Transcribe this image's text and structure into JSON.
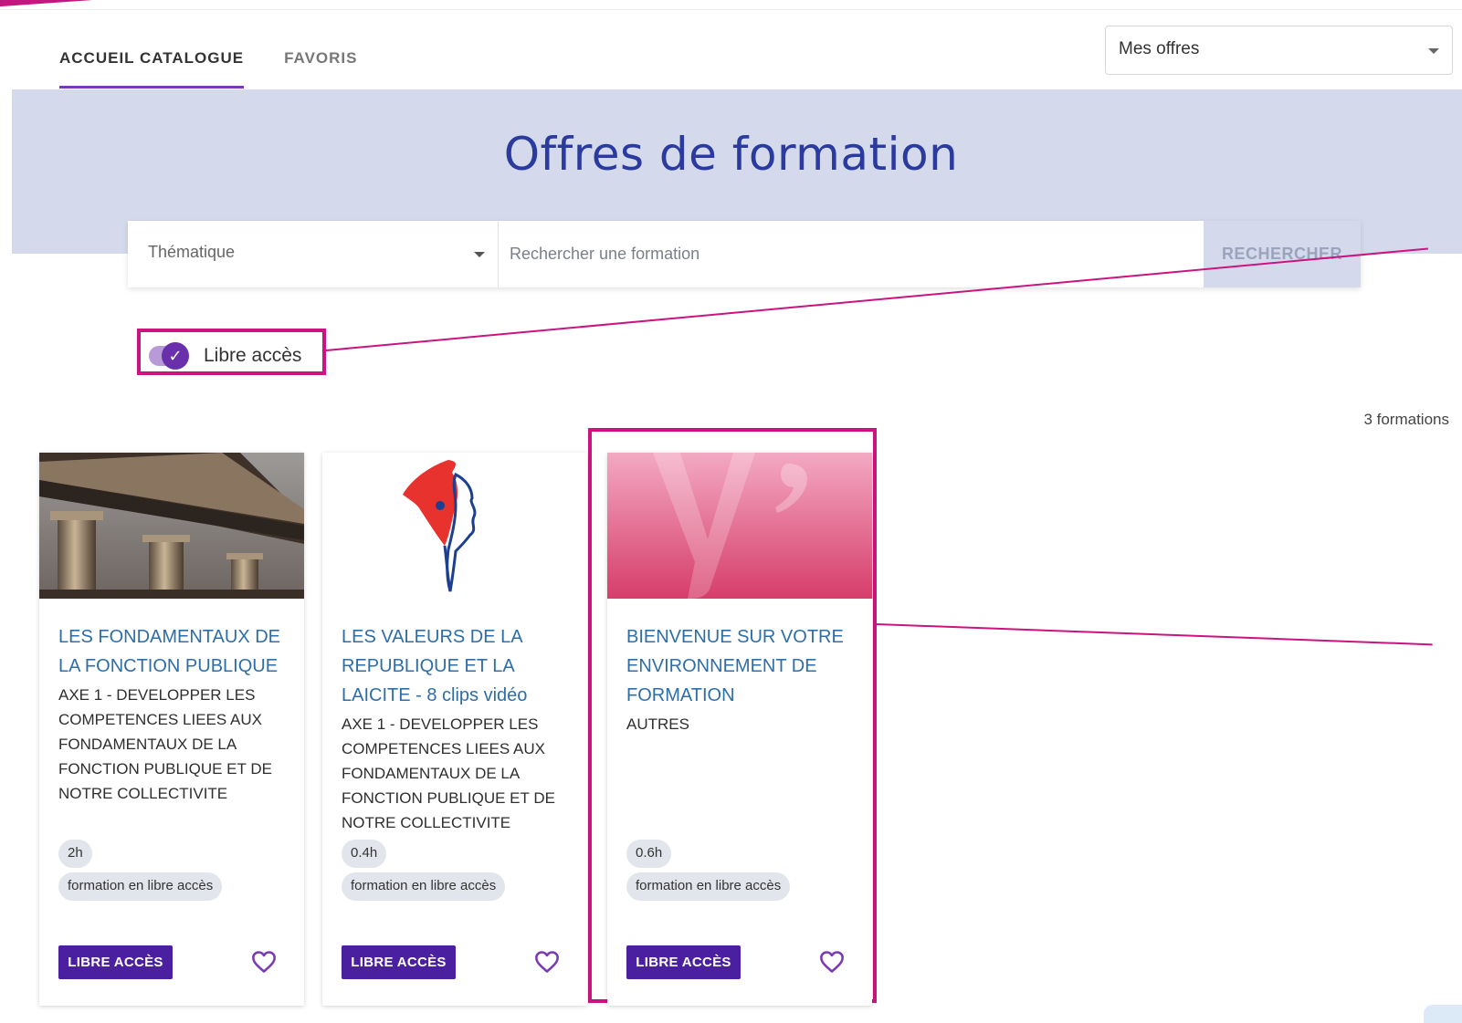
{
  "tabs": [
    {
      "label": "ACCUEIL CATALOGUE",
      "active": true
    },
    {
      "label": "FAVORIS",
      "active": false
    }
  ],
  "offer_select": {
    "value": "Mes offres"
  },
  "hero": {
    "title": "Offres de formation"
  },
  "search": {
    "theme_placeholder": "Thématique",
    "input_placeholder": "Rechercher une formation",
    "button_label": "RECHERCHER"
  },
  "filter": {
    "toggle_label": "Libre accès",
    "toggle_on": true
  },
  "results_count": "3 formations",
  "cards": [
    {
      "title": "LES FONDAMENTAUX DE LA FONCTION PUBLIQUE",
      "axis": "AXE 1 - DEVELOPPER LES COMPETENCES LIEES AUX FONDAMENTAUX DE LA FONCTION PUBLIQUE ET DE NOTRE COLLECTIVITE",
      "duration": "2h",
      "access_tag": "formation en libre accès",
      "button_label": "LIBRE ACCÈS",
      "image": "building-columns"
    },
    {
      "title": "LES VALEURS DE LA REPUBLIQUE ET LA LAICITE - 8 clips vidéo",
      "axis": "AXE 1 - DEVELOPPER LES COMPETENCES LIEES AUX FONDAMENTAUX DE LA FONCTION PUBLIQUE ET DE NOTRE COLLECTIVITE",
      "duration": "0.4h",
      "access_tag": "formation en libre accès",
      "button_label": "LIBRE ACCÈS",
      "image": "marianne-logo"
    },
    {
      "title": "BIENVENUE SUR VOTRE ENVIRONNEMENT DE FORMATION",
      "axis": "AUTRES",
      "duration": "0.6h",
      "access_tag": "formation en libre accès",
      "button_label": "LIBRE ACCÈS",
      "image": "pink-y-logo"
    }
  ],
  "colors": {
    "accent_purple": "#4a1fa0",
    "annotation_magenta": "#cc1480",
    "title_blue": "#2b3a9f",
    "hero_bg": "#d4daeb"
  }
}
